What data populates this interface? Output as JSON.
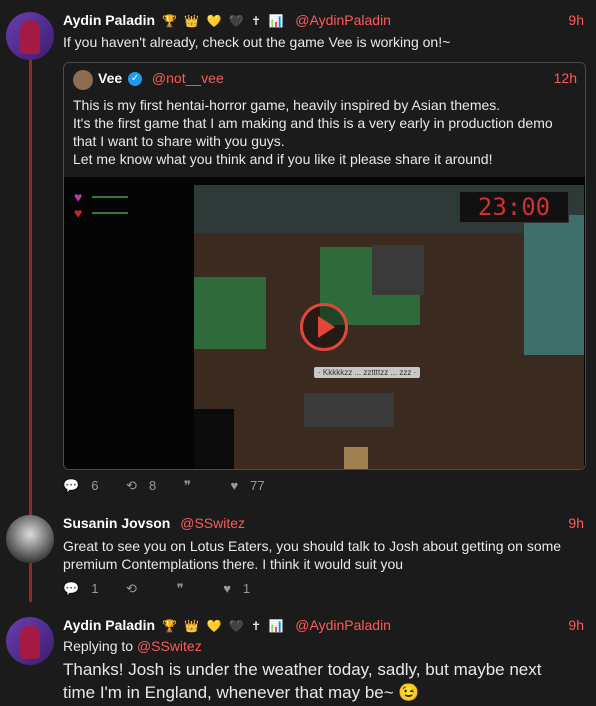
{
  "colors": {
    "accent": "#ff5a5a",
    "background": "#1b1b1b",
    "thread_line": "#8f2a2a"
  },
  "posts": [
    {
      "name": "Aydin Paladin",
      "badges": "🏆 👑 💛 🖤 ✝ 📊",
      "handle": "@AydinPaladin",
      "time": "9h",
      "text": "If you haven't already, check out the game Vee is working on!~",
      "quote": {
        "name": "Vee",
        "handle": "@not__vee",
        "time": "12h",
        "text_lines": [
          "This is my first hentai-horror game, heavily inspired by Asian themes.",
          "It's the first game that I am making and this is a very early in production demo",
          "that I want to share with you guys.",
          "Let me know what you think and if you like it please share it around!"
        ],
        "media": {
          "clock": "23:00",
          "speech": "· Kkkkkzz ... zzttttzz ... zzz ·",
          "play_icon": "play-icon"
        }
      },
      "stats": {
        "replies": "6",
        "retweets": "8",
        "quotes": "",
        "likes": "77"
      }
    },
    {
      "name": "Susanin Jovson",
      "handle": "@SSwitez",
      "time": "9h",
      "text_lines": [
        "Great to see you on Lotus Eaters, you should talk to Josh about getting on some",
        "premium Contemplations there. I think it would suit you"
      ],
      "stats": {
        "replies": "1",
        "retweets": "",
        "quotes": "",
        "likes": "1"
      }
    },
    {
      "name": "Aydin Paladin",
      "badges": "🏆 👑 💛 🖤 ✝ 📊",
      "handle": "@AydinPaladin",
      "time": "9h",
      "replying_prefix": "Replying to",
      "replying_handle": "@SSwitez",
      "text_lines": [
        "Thanks! Josh is under the weather today, sadly, but maybe next",
        "time I'm in England, whenever that may be~ 😉"
      ]
    }
  ],
  "icons": {
    "reply": "💬",
    "retweet": "⟲",
    "quote": "❞",
    "like": "♥"
  }
}
